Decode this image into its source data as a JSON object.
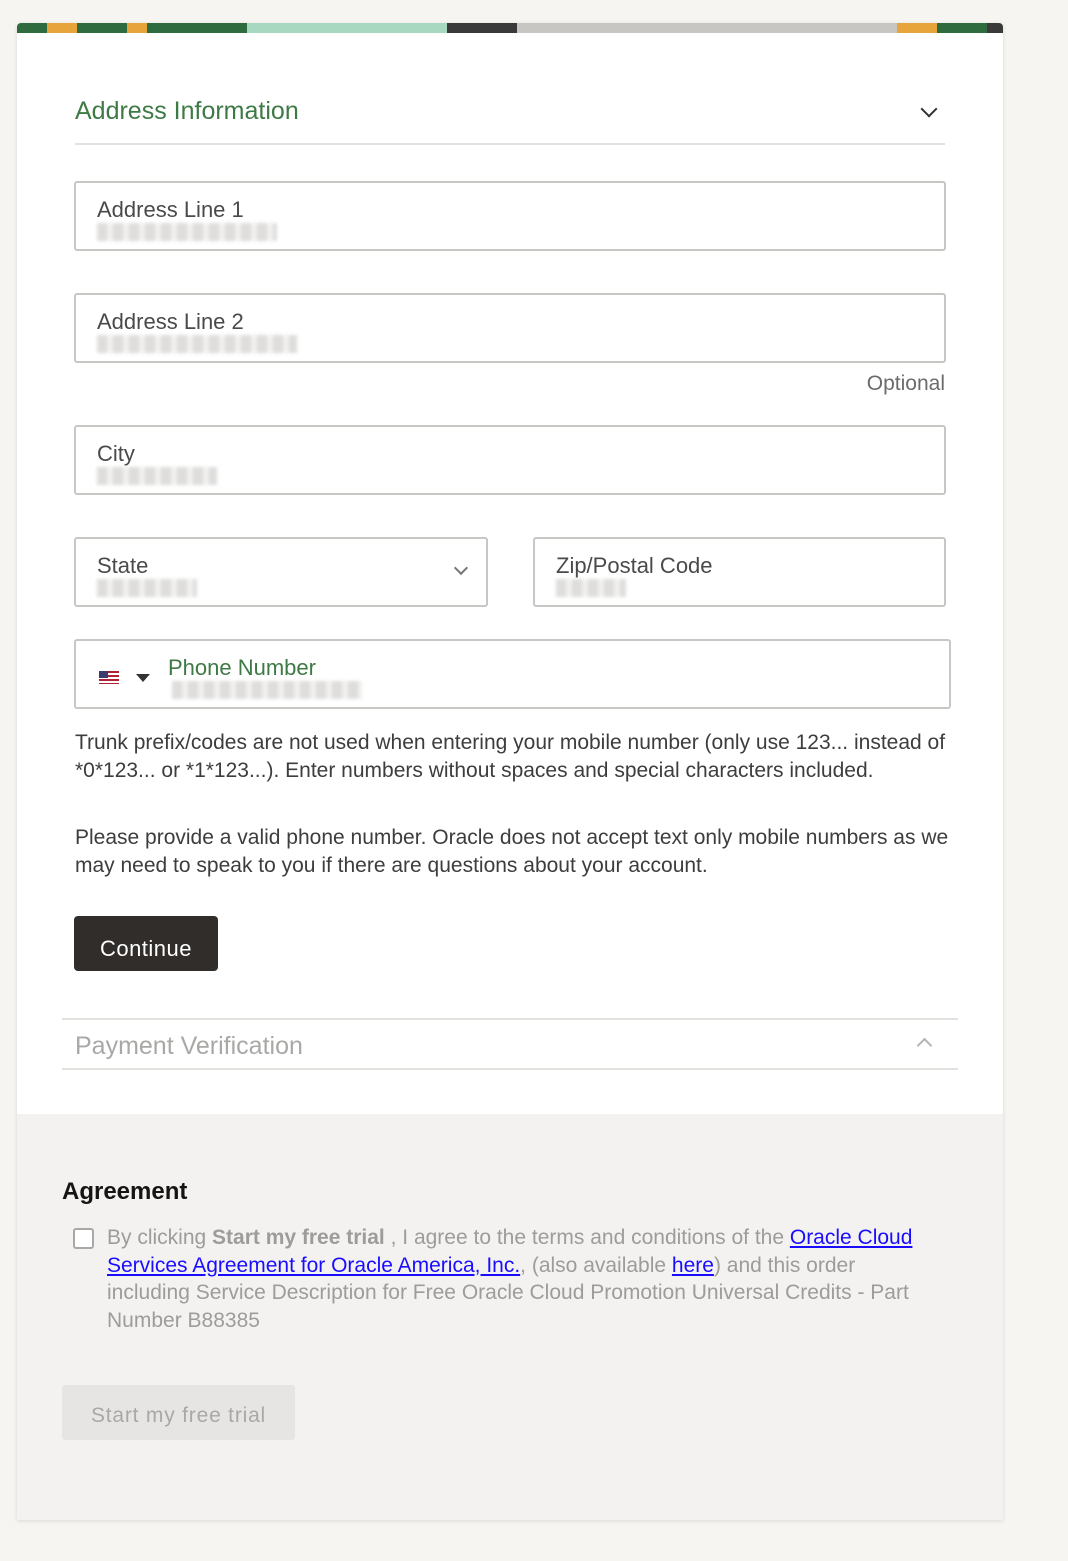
{
  "address_section": {
    "title": "Address Information",
    "fields": {
      "address1_label": "Address Line 1",
      "address2_label": "Address Line 2",
      "address2_hint": "Optional",
      "city_label": "City",
      "state_label": "State",
      "zip_label": "Zip/Postal Code",
      "phone_label": "Phone Number"
    },
    "help_text_1": "Trunk prefix/codes are not used when entering your mobile number (only use 123... instead of *0*123... or *1*123...). Enter numbers without spaces and special characters included.",
    "help_text_2": "Please provide a valid phone number. Oracle does not accept text only mobile numbers as we may need to speak to you if there are questions about your account.",
    "continue_label": "Continue"
  },
  "payment_section": {
    "title": "Payment Verification"
  },
  "agreement": {
    "title": "Agreement",
    "text_prefix": "By clicking ",
    "text_bold": "Start my free trial",
    "text_mid": " , I agree to the terms and conditions of the ",
    "link_csa": "Oracle Cloud Services Agreement for Oracle America, Inc.",
    "text_after_link": ", (also available ",
    "link_here": "here",
    "text_suffix": ") and this order including Service Description for Free Oracle Cloud Promotion Universal Credits - Part Number B88385",
    "start_button_label": "Start my free trial"
  },
  "icons": [
    "chevron-down-icon",
    "chevron-up-icon",
    "us-flag-icon",
    "caret-down-icon",
    "checkbox-icon"
  ],
  "colors": {
    "accent_green": "#3e7a45",
    "button_dark": "#312d2a",
    "link_blue": "#1a0dff",
    "disabled_gray": "#a9a8a6"
  }
}
